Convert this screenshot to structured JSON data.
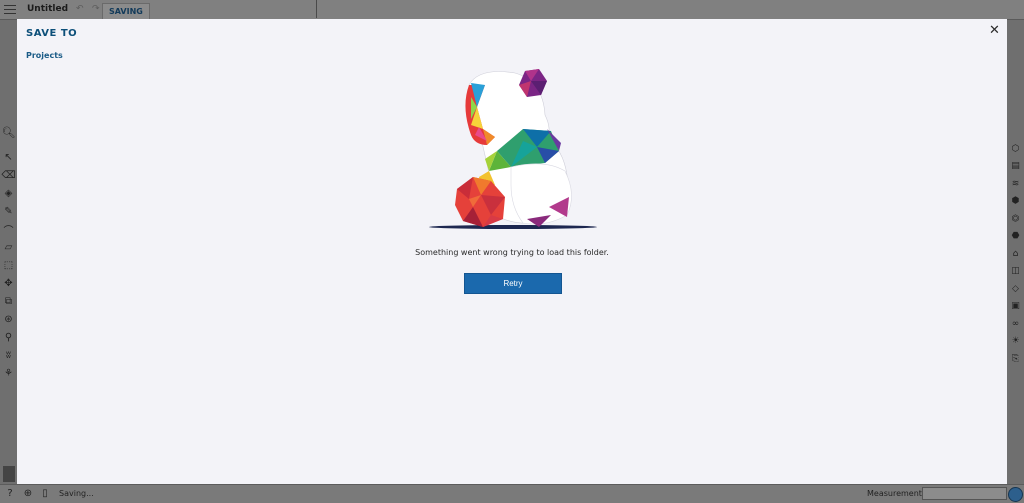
{
  "app": {
    "doc_title": "Untitled",
    "saving_badge": "SAVING",
    "status_text": "Saving...",
    "measurements_label": "Measurements"
  },
  "modal": {
    "title": "SAVE TO",
    "breadcrumb": "Projects",
    "error_message": "Something went wrong trying to load this folder.",
    "retry_label": "Retry",
    "close_glyph": "✕"
  },
  "icons": {
    "menu": "hamburger-menu-icon",
    "undo": "undo-icon",
    "redo": "redo-icon",
    "left_tools": [
      "search-icon",
      "select-icon",
      "eraser-icon",
      "paint-bucket-icon",
      "pencil-icon",
      "arc-icon",
      "rectangle-icon",
      "push-pull-icon",
      "move-icon",
      "offset-icon",
      "orbit-icon",
      "tape-measure-icon",
      "walk-icon",
      "section-icon"
    ],
    "right_tools": [
      "entity-info-icon",
      "components-icon",
      "layers-icon",
      "styles-icon",
      "scenes-icon",
      "materials-icon",
      "outliner-icon",
      "3d-warehouse-icon",
      "extension-icon",
      "tags-icon",
      "display-icon",
      "glasses-icon",
      "solar-icon",
      "clipboard-icon"
    ],
    "status": [
      "help-icon",
      "geo-location-icon",
      "credit-icon",
      "globe-icon"
    ]
  },
  "colors": {
    "modal_bg": "#f3f3f8",
    "title": "#0c4f79",
    "button": "#1b69ad"
  }
}
